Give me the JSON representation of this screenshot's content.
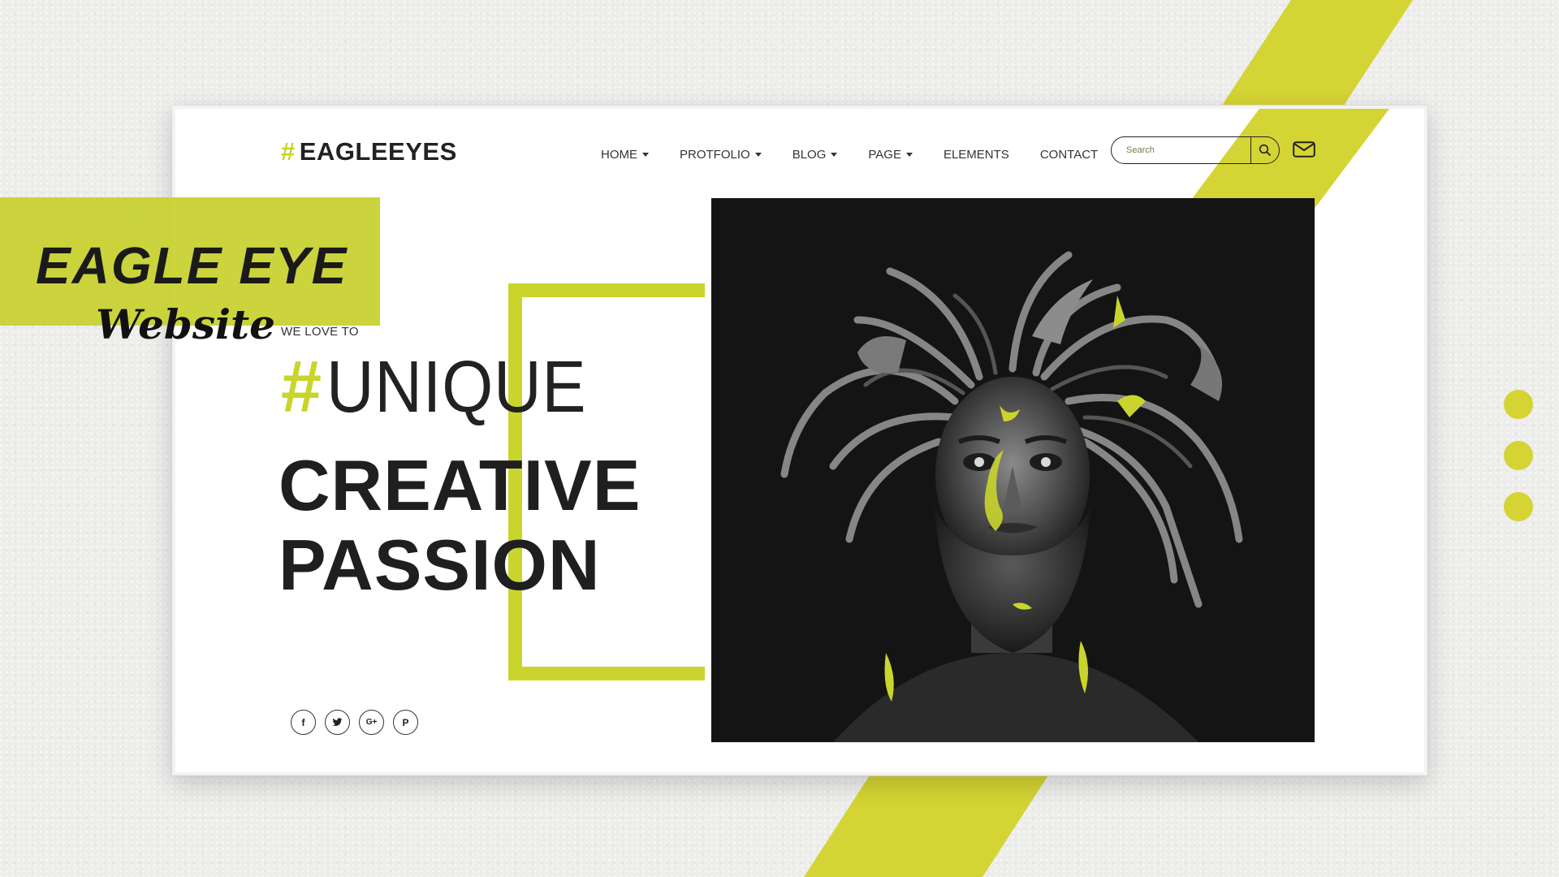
{
  "overlay": {
    "title": "EAGLE EYE",
    "subtitle": "Website"
  },
  "site": {
    "logo_hash": "#",
    "logo_text": "EAGLEEYES",
    "nav": [
      {
        "label": "HOME",
        "has_dropdown": true
      },
      {
        "label": "PROTFOLIO",
        "has_dropdown": true
      },
      {
        "label": "BLOG",
        "has_dropdown": true
      },
      {
        "label": "PAGE",
        "has_dropdown": true
      },
      {
        "label": "ELEMENTS",
        "has_dropdown": false
      },
      {
        "label": "CONTACT",
        "has_dropdown": false
      }
    ],
    "search": {
      "placeholder": "Search",
      "icon": "search-icon"
    },
    "mail_icon": "envelope-icon"
  },
  "hero": {
    "tagline": "WE LOVE TO",
    "hash": "#",
    "line1": "UNIQUE",
    "line2": "CREATIVE",
    "line3": "PASSION",
    "image_alt": "Portrait of a bearded man with antler and dreadlock headpiece"
  },
  "social": [
    {
      "name": "facebook",
      "glyph": "f"
    },
    {
      "name": "twitter",
      "glyph": "t"
    },
    {
      "name": "google-plus",
      "glyph": "G+"
    },
    {
      "name": "pinterest",
      "glyph": "P"
    }
  ],
  "colors": {
    "accent": "#d4d434",
    "text": "#222222",
    "background": "#ededeb"
  }
}
